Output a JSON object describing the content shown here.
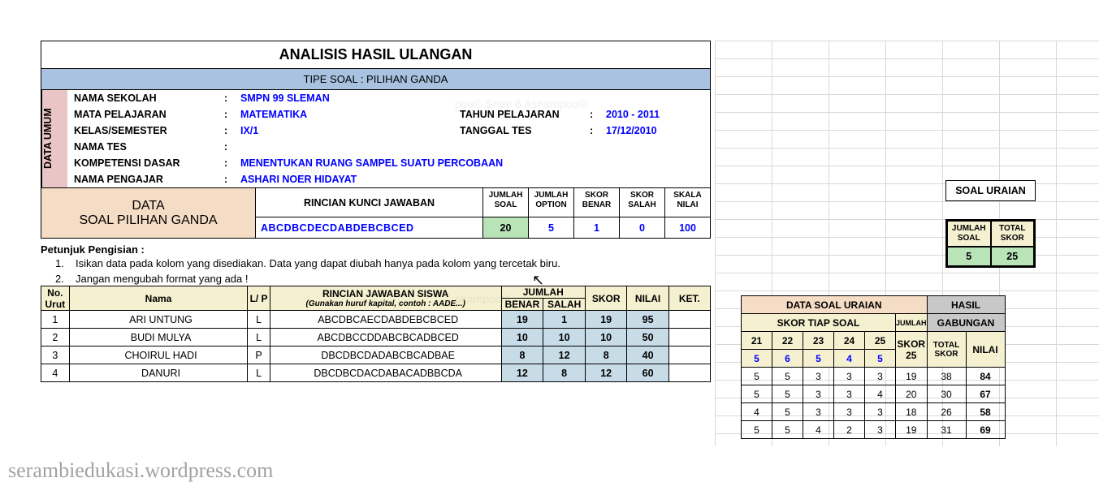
{
  "title": "ANALISIS HASIL ULANGAN",
  "subtitle": "TIPE SOAL : PILIHAN GANDA",
  "data_umum": {
    "label": "DATA UMUM",
    "rows": [
      {
        "key": "NAMA SEKOLAH",
        "val": "SMPN 99 SLEMAN",
        "key2": "",
        "val2": ""
      },
      {
        "key": "MATA PELAJARAN",
        "val": "MATEMATIKA",
        "key2": "TAHUN PELAJARAN",
        "val2": "2010 - 2011"
      },
      {
        "key": "KELAS/SEMESTER",
        "val": "IX/1",
        "key2": "TANGGAL TES",
        "val2": "17/12/2010"
      },
      {
        "key": "NAMA TES",
        "val": "",
        "key2": "",
        "val2": ""
      },
      {
        "key": "KOMPETENSI DASAR",
        "val": "MENENTUKAN RUANG SAMPEL SUATU PERCOBAAN",
        "key2": "",
        "val2": ""
      },
      {
        "key": "NAMA PENGAJAR",
        "val": "ASHARI NOER HIDAYAT",
        "key2": "",
        "val2": ""
      }
    ]
  },
  "spg": {
    "block_label1": "DATA",
    "block_label2": "SOAL PILIHAN GANDA",
    "key_label": "RINCIAN KUNCI JAWABAN",
    "key_value": "ABCDBCDECDABDEBCBCED",
    "cols": [
      {
        "head": "JUMLAH SOAL",
        "val": "20",
        "green": true,
        "blue": false
      },
      {
        "head": "JUMLAH OPTION",
        "val": "5",
        "green": false,
        "blue": true
      },
      {
        "head": "SKOR BENAR",
        "val": "1",
        "green": false,
        "blue": true
      },
      {
        "head": "SKOR SALAH",
        "val": "0",
        "green": false,
        "blue": true
      },
      {
        "head": "SKALA NILAI",
        "val": "100",
        "green": false,
        "blue": true
      }
    ]
  },
  "soal_uraian_box": {
    "title": "SOAL URAIAN",
    "heads": [
      "JUMLAH SOAL",
      "TOTAL SKOR"
    ],
    "vals": [
      "5",
      "25"
    ]
  },
  "instructions": {
    "title": "Petunjuk Pengisian :",
    "items": [
      "Isikan data pada kolom yang disediakan. Data yang dapat diubah hanya pada kolom yang tercetak biru.",
      "Jangan mengubah format yang ada !"
    ]
  },
  "student_headers": {
    "no": "No. Urut",
    "nama": "Nama",
    "lp": "L/ P",
    "rincian": "RINCIAN JAWABAN SISWA",
    "rincian_sub": "(Gunakan huruf kapital, contoh : AADE...)",
    "jumlah": "JUMLAH",
    "benar": "BENAR",
    "salah": "SALAH",
    "skor": "SKOR",
    "nilai": "NILAI",
    "ket": "KET."
  },
  "students": [
    {
      "no": "1",
      "nama": "ARI UNTUNG",
      "lp": "L",
      "jawab": "ABCDBCAECDABDEBCBCED",
      "benar": "19",
      "salah": "1",
      "skor": "19",
      "nilai": "95",
      "ket": ""
    },
    {
      "no": "2",
      "nama": "BUDI MULYA",
      "lp": "L",
      "jawab": "ABCDBCCDDABCBCADBCED",
      "benar": "10",
      "salah": "10",
      "skor": "10",
      "nilai": "50",
      "ket": ""
    },
    {
      "no": "3",
      "nama": "CHOIRUL HADI",
      "lp": "P",
      "jawab": "DBCDBCDADABCBCADBAE",
      "benar": "8",
      "salah": "12",
      "skor": "8",
      "nilai": "40",
      "ket": ""
    },
    {
      "no": "4",
      "nama": "DANURI",
      "lp": "L",
      "jawab": "DBCDBCDACDABACADBBCDA",
      "benar": "12",
      "salah": "8",
      "skor": "12",
      "nilai": "60",
      "ket": ""
    }
  ],
  "uraian": {
    "title1": "DATA SOAL URAIAN",
    "title2": "HASIL",
    "sub1": "SKOR TIAP SOAL",
    "sub2": "JUMLAH",
    "sub3": "GABUNGAN",
    "q_nums": [
      "21",
      "22",
      "23",
      "24",
      "25"
    ],
    "skor_label": "SKOR",
    "total_label": "TOTAL SKOR",
    "nilai_label": "NILAI",
    "max_scores": [
      "5",
      "6",
      "5",
      "4",
      "5"
    ],
    "max_total": "25",
    "rows": [
      {
        "scores": [
          "5",
          "5",
          "3",
          "3",
          "3"
        ],
        "jum": "19",
        "total": "38",
        "nilai": "84"
      },
      {
        "scores": [
          "5",
          "5",
          "3",
          "3",
          "4"
        ],
        "jum": "20",
        "total": "30",
        "nilai": "67"
      },
      {
        "scores": [
          "4",
          "5",
          "3",
          "3",
          "3"
        ],
        "jum": "18",
        "total": "26",
        "nilai": "58"
      },
      {
        "scores": [
          "5",
          "5",
          "4",
          "2",
          "3"
        ],
        "jum": "19",
        "total": "31",
        "nilai": "69"
      }
    ]
  },
  "watermark": "serambiedukasi.wordpress.com"
}
